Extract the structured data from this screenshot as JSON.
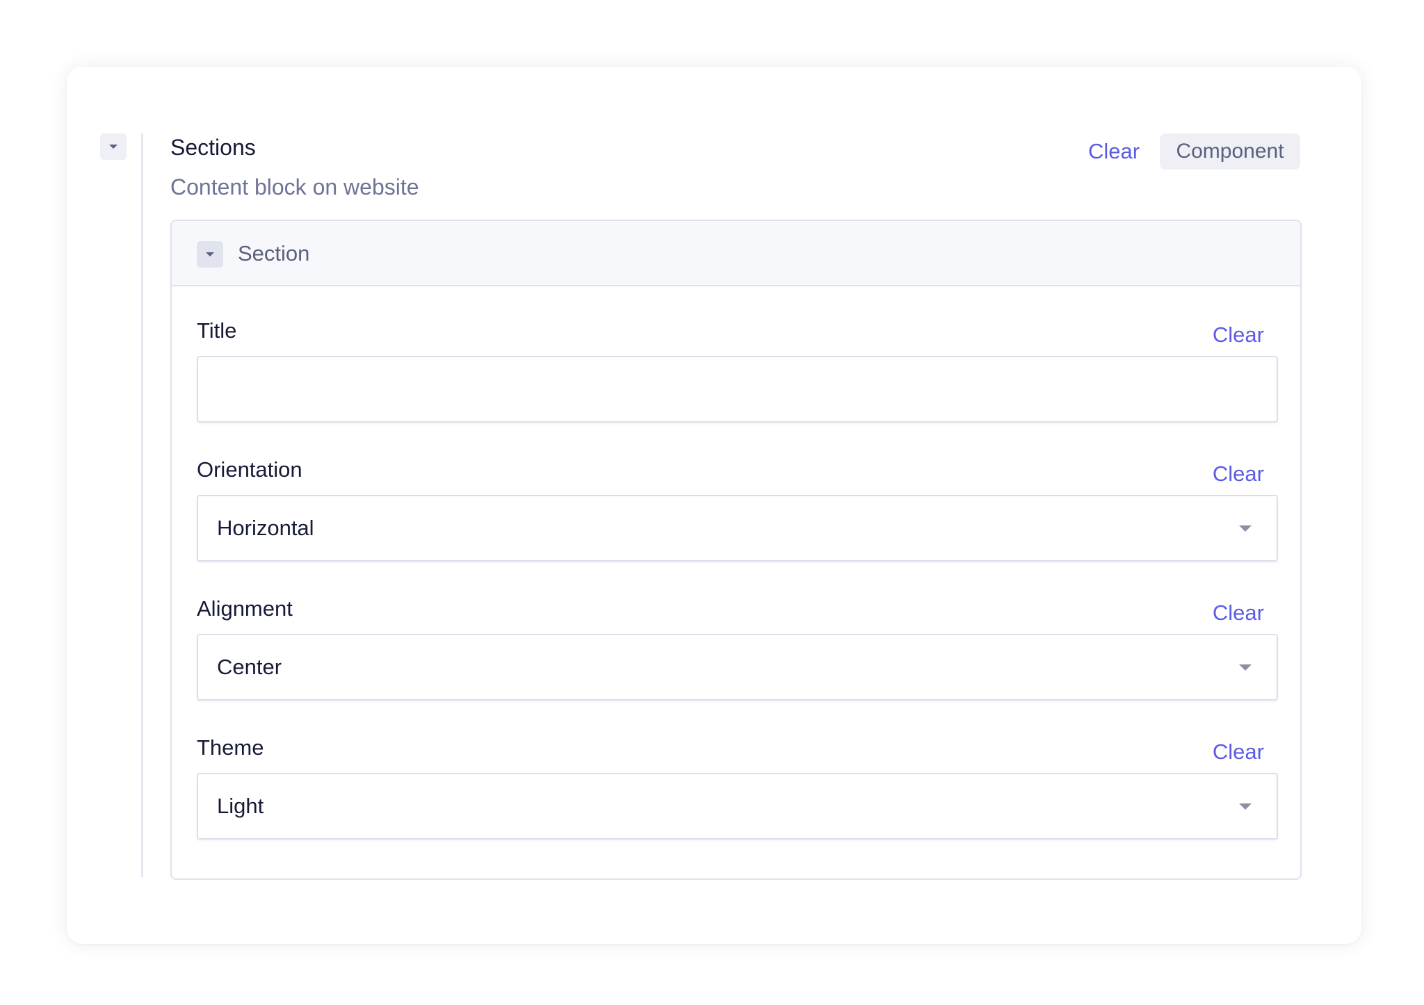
{
  "group": {
    "title": "Sections",
    "description": "Content block on website",
    "clear_label": "Clear",
    "component_tag": "Component"
  },
  "section": {
    "title": "Section",
    "fields": {
      "title": {
        "label": "Title",
        "clear_label": "Clear",
        "value": ""
      },
      "orientation": {
        "label": "Orientation",
        "clear_label": "Clear",
        "value": "Horizontal"
      },
      "alignment": {
        "label": "Alignment",
        "clear_label": "Clear",
        "value": "Center"
      },
      "theme": {
        "label": "Theme",
        "clear_label": "Clear",
        "value": "Light"
      }
    }
  },
  "colors": {
    "accent": "#5b5be6",
    "border": "#dfe2ee",
    "muted_text": "#6e7495"
  },
  "icons": {
    "collapse": "caret-down-icon",
    "select": "chevron-down-icon"
  }
}
